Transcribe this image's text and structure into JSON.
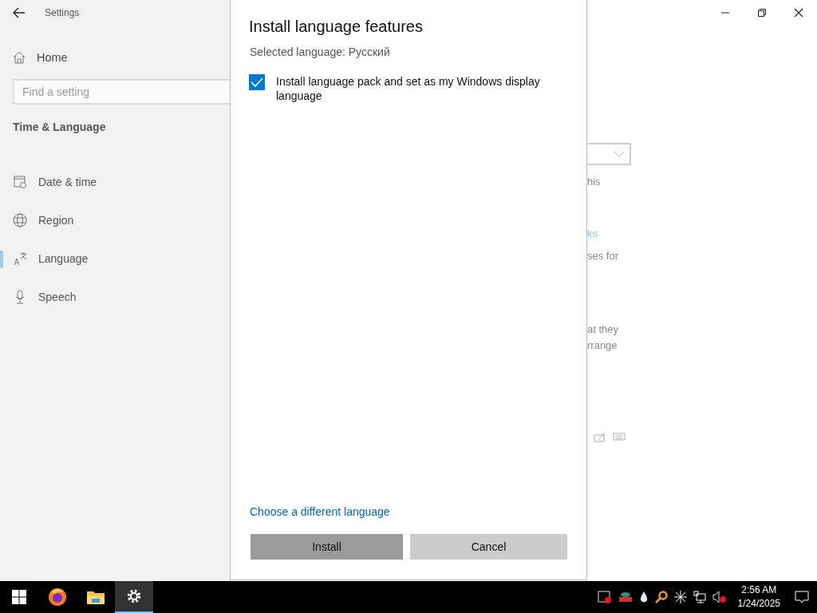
{
  "window": {
    "title": "Settings"
  },
  "sidebar": {
    "home": "Home",
    "search": {
      "placeholder": "Find a setting"
    },
    "section": "Time & Language",
    "items": [
      {
        "label": "Date & time",
        "kind": "calendar",
        "selected": false
      },
      {
        "label": "Region",
        "kind": "globe",
        "selected": false
      },
      {
        "label": "Language",
        "kind": "language",
        "selected": true
      },
      {
        "label": "Speech",
        "kind": "microphone",
        "selected": false
      }
    ]
  },
  "dialog": {
    "title": "Install language features",
    "subtitle": "Selected language: Русский",
    "options": [
      {
        "label": "Install language pack and set as my Windows display language",
        "checked": true
      }
    ],
    "link": "Choose a different language",
    "buttons": [
      {
        "label": "Install",
        "kind": "primary"
      },
      {
        "label": "Cancel",
        "kind": "secondary"
      }
    ]
  },
  "background_texts": [
    {
      "text": "his",
      "kind": "text"
    },
    {
      "text": "ks",
      "kind": "link"
    },
    {
      "text": "ses for",
      "kind": "text"
    },
    {
      "text": "at they",
      "kind": "text"
    },
    {
      "text": "rrange",
      "kind": "text"
    }
  ],
  "taskbar": {
    "apps": [
      {
        "kind": "start",
        "selected": false
      },
      {
        "kind": "browser",
        "selected": false
      },
      {
        "kind": "folder",
        "selected": false
      },
      {
        "kind": "settings",
        "selected": true
      }
    ],
    "time": "2:56 AM",
    "date": "1/24/2025"
  }
}
